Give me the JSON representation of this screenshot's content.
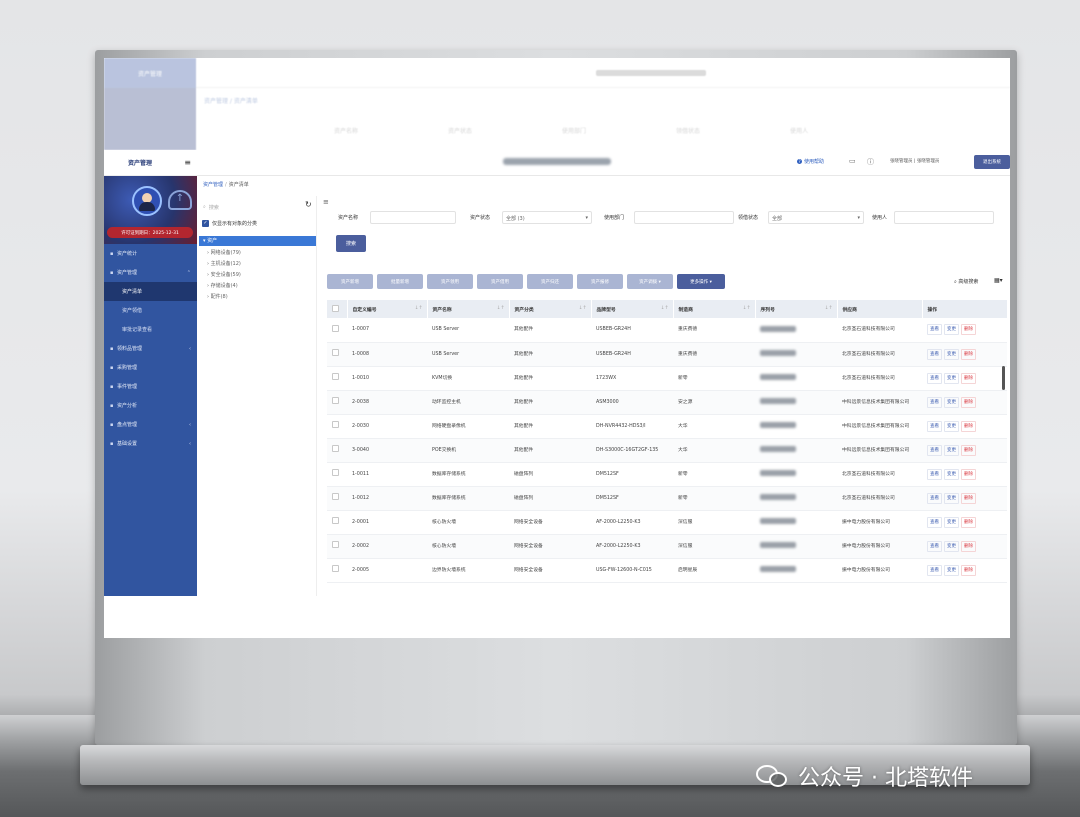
{
  "app": {
    "logo": "资产管理",
    "license": "许可证到期日：2025-12-31",
    "help": "使用帮助",
    "user_info": "张晓管理员 | 张晓管理员",
    "logout": "退出系统"
  },
  "breadcrumb": {
    "parent": "资产管理",
    "current": "资产清单"
  },
  "sidebar": {
    "items": [
      {
        "label": "资产统计",
        "icon": "chart-icon",
        "arrow": ""
      },
      {
        "label": "资产管理",
        "icon": "asset-icon",
        "arrow": "⌃"
      },
      {
        "label": "资产清单",
        "sub": true,
        "active": true
      },
      {
        "label": "资产领借",
        "sub": true
      },
      {
        "label": "审批记录查看",
        "sub": true
      },
      {
        "label": "领料品管理",
        "icon": "box-icon",
        "arrow": "‹"
      },
      {
        "label": "采购管理",
        "icon": "cart-icon",
        "arrow": ""
      },
      {
        "label": "事件管理",
        "icon": "event-icon",
        "arrow": ""
      },
      {
        "label": "资产分析",
        "icon": "analysis-icon",
        "arrow": ""
      },
      {
        "label": "盘点管理",
        "icon": "inventory-icon",
        "arrow": "‹"
      },
      {
        "label": "基础设置",
        "icon": "settings-icon",
        "arrow": "‹"
      }
    ]
  },
  "tree": {
    "search_placeholder": "搜索",
    "show_empty": "仅显示有对象的分类",
    "root": "资产",
    "nodes": [
      "网络设备(79)",
      "主机设备(12)",
      "安全设备(59)",
      "存储设备(4)",
      "配件(8)"
    ]
  },
  "filters": {
    "name_label": "资产名称",
    "status_label": "资产状态",
    "status_value": "全部 (3)",
    "dept_label": "使用部门",
    "lease_label": "领借状态",
    "lease_value": "全部",
    "user_label": "使用人",
    "search_button": "搜索"
  },
  "toolbar": {
    "buttons": [
      "资产新增",
      "批量新增",
      "资产领用",
      "资产借用",
      "资产归还",
      "资产报修",
      "资产调拨 ▾",
      "更多操作 ▾"
    ],
    "advanced": "高级搜索"
  },
  "table": {
    "headers": [
      "自定义编号",
      "资产名称",
      "资产分类",
      "品牌型号",
      "制造商",
      "序列号",
      "供应商",
      "操作"
    ],
    "actions": [
      "查看",
      "变更",
      "删除"
    ],
    "rows": [
      [
        "1-0007",
        "USB Server",
        "其他配件",
        "USBEB-GR24H",
        "重庆费德",
        "北京圣石道科技有限公司"
      ],
      [
        "1-0008",
        "USB Server",
        "其他配件",
        "USBEB-GR24H",
        "重庆费德",
        "北京圣石道科技有限公司"
      ],
      [
        "1-0010",
        "KVM切换",
        "其他配件",
        "1723WX",
        "新零",
        "北京圣石道科技有限公司"
      ],
      [
        "2-0038",
        "动环监控主机",
        "其他配件",
        "ASM3000",
        "安之源",
        "中科远景信息技术集团有限公司"
      ],
      [
        "2-0030",
        "网络硬盘录像机",
        "其他配件",
        "DH-NVR4432-HDS3/I",
        "大华",
        "中科远景信息技术集团有限公司"
      ],
      [
        "3-0040",
        "POE交换机",
        "其他配件",
        "DH-S3000C-16GT2GF-135",
        "大华",
        "中科远景信息技术集团有限公司"
      ],
      [
        "1-0011",
        "数据库存储系统",
        "磁盘阵列",
        "DM512SF",
        "新零",
        "北京圣石道科技有限公司"
      ],
      [
        "1-0012",
        "数据库存储系统",
        "磁盘阵列",
        "DM512SF",
        "新零",
        "北京圣石道科技有限公司"
      ],
      [
        "2-0001",
        "核心防火墙",
        "网络安全设备",
        "AF-2000-L2250-K3",
        "深信服",
        "振中电力股份有限公司"
      ],
      [
        "2-0002",
        "核心防火墙",
        "网络安全设备",
        "AF-2000-L2250-K3",
        "深信服",
        "振中电力股份有限公司"
      ],
      [
        "2-0005",
        "边界防火墙系统",
        "网络安全设备",
        "USG-FW-12600-N-C015",
        "启明星辰",
        "振中电力股份有限公司"
      ]
    ]
  },
  "ghost": {
    "breadcrumb": "资产管理 / 资产清单",
    "filter": [
      "资产名称",
      "资产状态",
      "使用部门",
      "领借状态",
      "使用人"
    ]
  },
  "watermark": "公众号 · 北塔软件"
}
